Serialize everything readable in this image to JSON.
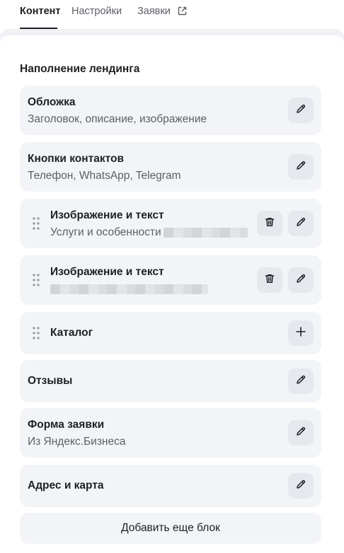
{
  "tabs": [
    {
      "label": "Контент",
      "active": true
    },
    {
      "label": "Настройки",
      "active": false
    },
    {
      "label": "Заявки",
      "active": false,
      "icon": "external-link-icon"
    }
  ],
  "section": {
    "title": "Наполнение лендинга"
  },
  "blocks": [
    {
      "title": "Обложка",
      "subtitle": "Заголовок, описание, изображение",
      "actions": [
        "edit"
      ]
    },
    {
      "title": "Кнопки контактов",
      "subtitle": "Телефон, WhatsApp, Telegram",
      "actions": [
        "edit"
      ]
    },
    {
      "title": "Изображение и текст",
      "subtitle": "Услуги и особенности",
      "draggable": true,
      "actions": [
        "delete",
        "edit"
      ]
    },
    {
      "title": "Изображение и текст",
      "subtitle": "",
      "draggable": true,
      "actions": [
        "delete",
        "edit"
      ]
    },
    {
      "title": "Каталог",
      "subtitle": "",
      "draggable": true,
      "actions": [
        "add"
      ]
    },
    {
      "title": "Отзывы",
      "subtitle": "",
      "actions": [
        "edit"
      ]
    },
    {
      "title": "Форма заявки",
      "subtitle": "Из Яндекс.Бизнеса",
      "actions": [
        "edit"
      ]
    },
    {
      "title": "Адрес и карта",
      "subtitle": "",
      "actions": [
        "edit"
      ]
    }
  ],
  "add_block_label": "Добавить еще блок",
  "colors": {
    "card_bg": "#f3f4f8",
    "button_bg": "#e7e8ee",
    "text": "#1f2024",
    "muted": "#5c5f66"
  }
}
